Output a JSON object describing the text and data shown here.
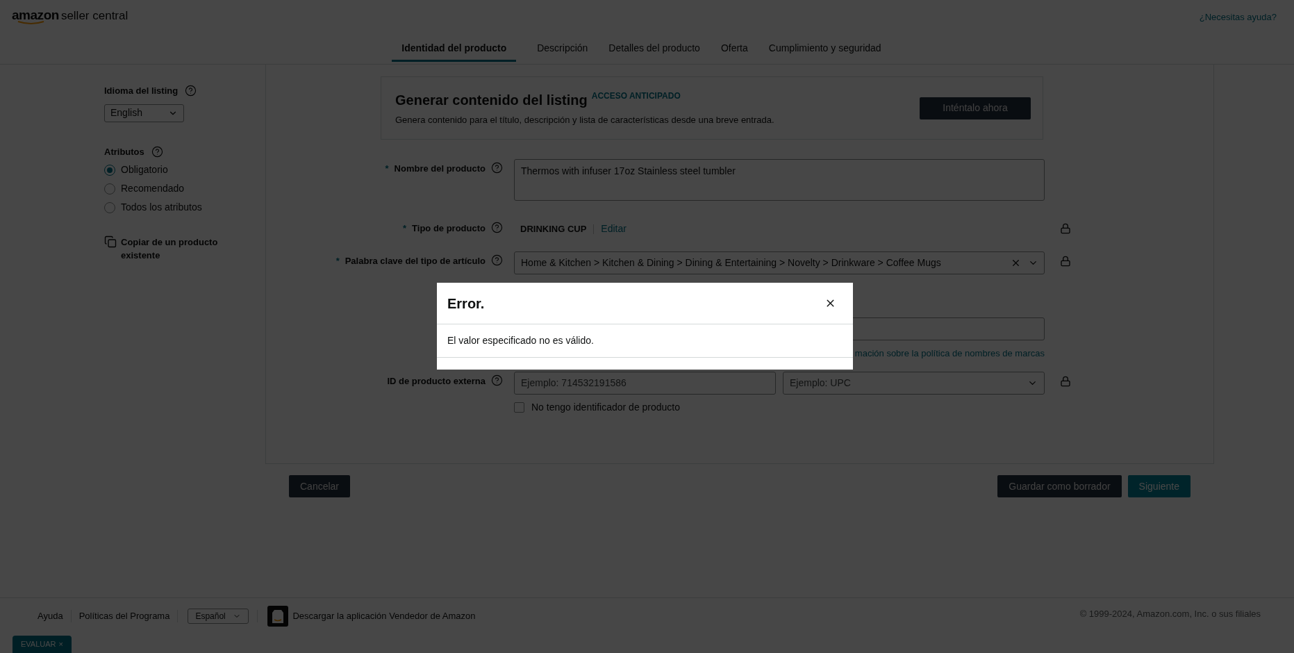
{
  "header": {
    "logo_word": "amazon",
    "logo_suffix": "seller central",
    "help_link": "¿Necesitas ayuda?"
  },
  "tabs": [
    {
      "label": "Identidad del producto",
      "selected": true
    },
    {
      "label": "Descripción",
      "selected": false
    },
    {
      "label": "Detalles del producto",
      "selected": false
    },
    {
      "label": "Oferta",
      "selected": false
    },
    {
      "label": "Cumplimiento y seguridad",
      "selected": false
    }
  ],
  "sidebar": {
    "language": {
      "label": "Idioma del listing",
      "value": "English"
    },
    "attributes": {
      "label": "Atributos",
      "options": [
        {
          "label": "Obligatorio",
          "selected": true
        },
        {
          "label": "Recomendado",
          "selected": false
        },
        {
          "label": "Todos los atributos",
          "selected": false
        }
      ]
    },
    "copy_link": "Copiar de un producto existente"
  },
  "promo": {
    "title": "Generar contenido del listing",
    "badge": "ACCESO ANTICIPADO",
    "text": "Genera contenido para el título, descripción y lista de características desde una breve entrada.",
    "button": "Inténtalo ahora"
  },
  "fields": [
    {
      "kind": "textarea",
      "label": "Nombre del producto",
      "required_mark": "*",
      "value": "Thermos with infuser 17oz Stainless steel tumbler",
      "locked": false
    },
    {
      "kind": "product_type",
      "label": "Tipo de producto",
      "required_mark": "*",
      "value": "DRINKING CUP",
      "action": "Editar",
      "locked": true
    },
    {
      "kind": "select",
      "label": "Palabra clave del tipo de artículo",
      "required_mark": "*",
      "value": "Home & Kitchen > Kitchen & Dining > Dining & Entertaining > Novelty > Drinkware > Coffee Mugs",
      "locked": true
    },
    {
      "kind": "covered",
      "link": "mación sobre la política de nombres de marcas",
      "locked": false
    },
    {
      "kind": "id_pair",
      "label": "ID de producto externa",
      "placeholder": "Ejemplo: 714532191586",
      "type_placeholder": "Ejemplo: UPC",
      "locked": true,
      "checkbox": {
        "label": "No tengo identificador de producto",
        "checked": false
      }
    }
  ],
  "actions": {
    "cancel": "Cancelar",
    "save_draft": "Guardar como borrador",
    "next": "Siguiente"
  },
  "footer": {
    "links": [
      "Ayuda",
      "Políticas del Programa"
    ],
    "language": "Español",
    "app_link": "Descargar la aplicación Vendedor de Amazon",
    "copyright": "© 1999-2024, Amazon.com, Inc. o sus filiales"
  },
  "feedback_tab": {
    "label": "EVALUAR",
    "close": "×"
  },
  "dialog": {
    "title": "Error.",
    "message": "El valor especificado no es válido."
  }
}
